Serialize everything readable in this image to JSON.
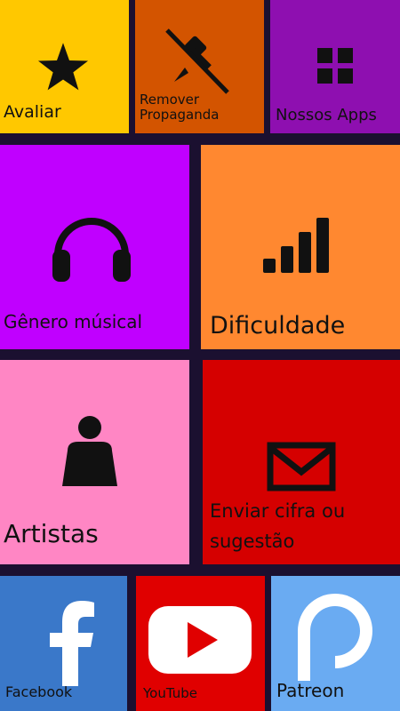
{
  "tiles": {
    "rate": {
      "label": "Avaliar",
      "color": "#ffc800",
      "icon": "star-icon"
    },
    "remove_ads": {
      "label_line1": "Remover",
      "label_line2": "Propaganda",
      "color": "#d35400",
      "icon": "unpin-icon"
    },
    "our_apps": {
      "label": "Nossos Apps",
      "color": "#8e0fb0",
      "icon": "grid-icon"
    },
    "genre": {
      "label": "Gênero músical",
      "color": "#c000ff",
      "icon": "headphones-icon"
    },
    "difficulty": {
      "label": "Dificuldade",
      "color": "#ff8830",
      "icon": "signal-bars-icon"
    },
    "artists": {
      "label": "Artistas",
      "color": "#ff86c4",
      "icon": "person-icon"
    },
    "send_chord": {
      "label_line1": "Enviar cifra ou",
      "label_line2": "sugestão",
      "color": "#d50000",
      "icon": "envelope-icon"
    },
    "facebook": {
      "label": "Facebook",
      "color": "#3a78c9",
      "icon": "facebook-icon"
    },
    "youtube": {
      "label": "YouTube",
      "color": "#e00000",
      "icon": "youtube-icon"
    },
    "patreon": {
      "label": "Patreon",
      "color": "#6aabf2",
      "icon": "patreon-icon"
    }
  }
}
